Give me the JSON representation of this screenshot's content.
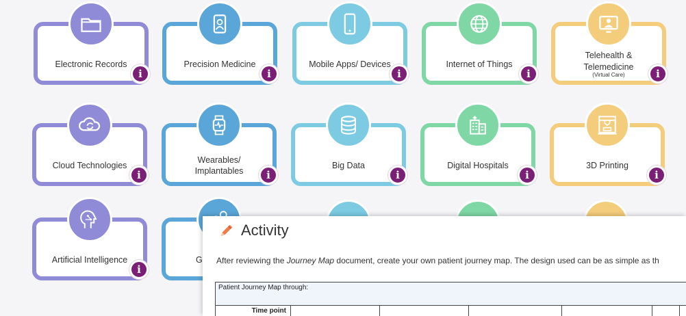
{
  "tiles": [
    {
      "label": "Electronic Records",
      "icon": "folder-icon",
      "color": "#8f8bd6"
    },
    {
      "label": "Precision Medicine",
      "icon": "id-badge-icon",
      "color": "#5aa6d8"
    },
    {
      "label": "Mobile Apps/ Devices",
      "icon": "smartphone-icon",
      "color": "#7ccbe3"
    },
    {
      "label": "Internet of Things",
      "icon": "globe-icon",
      "color": "#7fd7a5"
    },
    {
      "label": "Telehealth & Telemedicine",
      "sublabel": "(Virtual Care)",
      "icon": "video-doctor-icon",
      "color": "#f4cd7c"
    },
    {
      "label": "Cloud Technologies",
      "icon": "cloud-sync-icon",
      "color": "#8f8bd6"
    },
    {
      "label": "Wearables/ Implantables",
      "icon": "smartwatch-icon",
      "color": "#5aa6d8"
    },
    {
      "label": "Big Data",
      "icon": "database-icon",
      "color": "#7ccbe3"
    },
    {
      "label": "Digital Hospitals",
      "icon": "hospital-icon",
      "color": "#7fd7a5"
    },
    {
      "label": "3D Printing",
      "icon": "3d-printer-icon",
      "color": "#f4cd7c"
    },
    {
      "label": "Artificial Intelligence",
      "icon": "ai-head-icon",
      "color": "#8f8bd6"
    },
    {
      "label": "G",
      "icon": "gears-icon",
      "color": "#5aa6d8"
    }
  ],
  "info_glyph": "i",
  "activity": {
    "title": "Activity",
    "instruction_before": "After reviewing the ",
    "instruction_doc": "Journey Map",
    "instruction_after": " document, create your own patient journey map. The design used can be as simple as th",
    "table_header": "Patient Journey Map through:",
    "time_point_label": "Time point"
  }
}
